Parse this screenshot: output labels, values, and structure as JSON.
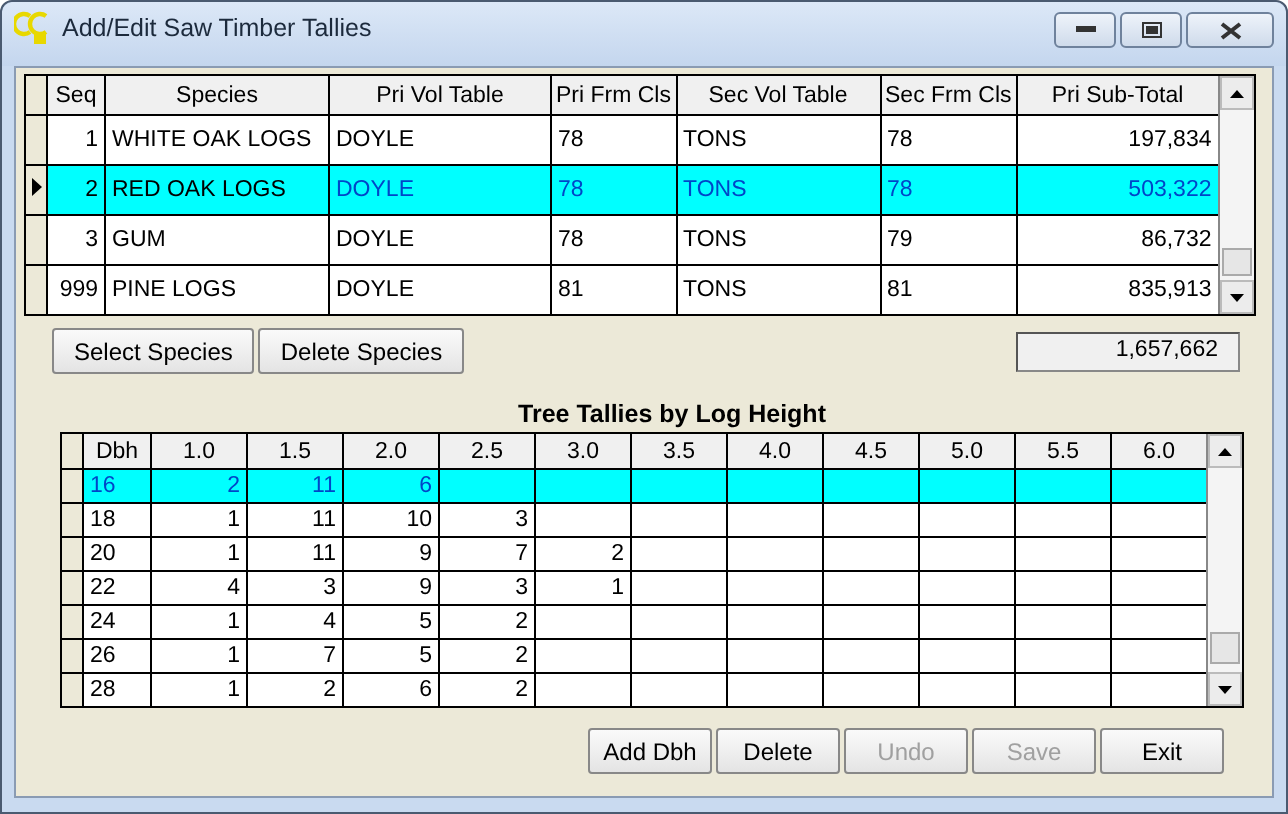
{
  "window": {
    "title": "Add/Edit Saw Timber Tallies"
  },
  "species_table": {
    "columns": [
      "Seq",
      "Species",
      "Pri Vol Table",
      "Pri Frm Cls",
      "Sec Vol Table",
      "Sec Frm Cls",
      "Pri Sub-Total"
    ],
    "rows": [
      {
        "seq": "1",
        "species": "WHITE OAK LOGS",
        "pri_vol_table": "DOYLE",
        "pri_frm_cls": "78",
        "sec_vol_table": "TONS",
        "sec_frm_cls": "78",
        "pri_sub_total": "197,834",
        "selected": false
      },
      {
        "seq": "2",
        "species": "RED OAK LOGS",
        "pri_vol_table": "DOYLE",
        "pri_frm_cls": "78",
        "sec_vol_table": "TONS",
        "sec_frm_cls": "78",
        "pri_sub_total": "503,322",
        "selected": true
      },
      {
        "seq": "3",
        "species": "GUM",
        "pri_vol_table": "DOYLE",
        "pri_frm_cls": "78",
        "sec_vol_table": "TONS",
        "sec_frm_cls": "79",
        "pri_sub_total": "86,732",
        "selected": false
      },
      {
        "seq": "999",
        "species": "PINE LOGS",
        "pri_vol_table": "DOYLE",
        "pri_frm_cls": "81",
        "sec_vol_table": "TONS",
        "sec_frm_cls": "81",
        "pri_sub_total": "835,913",
        "selected": false
      }
    ]
  },
  "species_buttons": [
    {
      "label": "Select Species",
      "disabled": false
    },
    {
      "label": "Delete Species",
      "disabled": false
    }
  ],
  "grand_total": "1,657,662",
  "tally_table": {
    "title": "Tree Tallies by Log Height",
    "dbh_header": "Dbh",
    "heights": [
      "1.0",
      "1.5",
      "2.0",
      "2.5",
      "3.0",
      "3.5",
      "4.0",
      "4.5",
      "5.0",
      "5.5",
      "6.0"
    ],
    "rows": [
      {
        "dbh": "16",
        "tallies": [
          "2",
          "11",
          "6"
        ],
        "selected": true
      },
      {
        "dbh": "18",
        "tallies": [
          "1",
          "11",
          "10",
          "3"
        ],
        "selected": false
      },
      {
        "dbh": "20",
        "tallies": [
          "1",
          "11",
          "9",
          "7",
          "2"
        ],
        "selected": false
      },
      {
        "dbh": "22",
        "tallies": [
          "4",
          "3",
          "9",
          "3",
          "1"
        ],
        "selected": false
      },
      {
        "dbh": "24",
        "tallies": [
          "1",
          "4",
          "5",
          "2"
        ],
        "selected": false
      },
      {
        "dbh": "26",
        "tallies": [
          "1",
          "7",
          "5",
          "2"
        ],
        "selected": false
      },
      {
        "dbh": "28",
        "tallies": [
          "1",
          "2",
          "6",
          "2"
        ],
        "selected": false
      }
    ]
  },
  "buttons": [
    {
      "label": "Add Dbh",
      "disabled": false
    },
    {
      "label": "Delete",
      "disabled": false
    },
    {
      "label": "Undo",
      "disabled": true
    },
    {
      "label": "Save",
      "disabled": true
    },
    {
      "label": "Exit",
      "disabled": false
    }
  ]
}
